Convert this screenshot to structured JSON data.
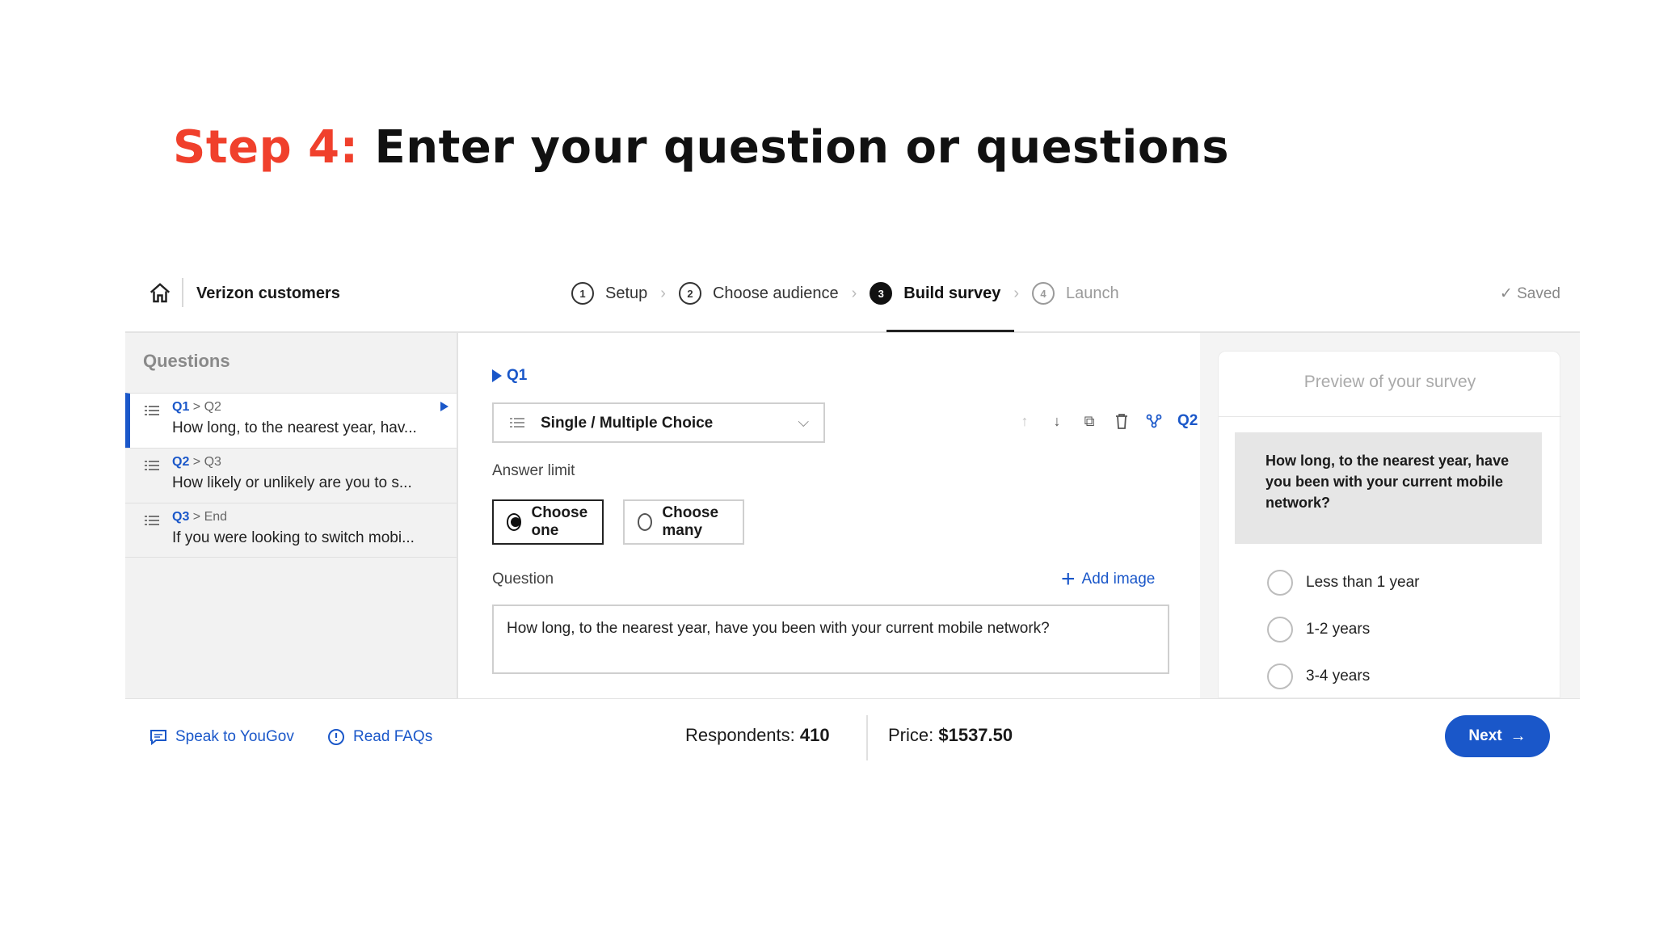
{
  "headline": {
    "step": "Step 4:",
    "text": "Enter your question or questions"
  },
  "topbar": {
    "project": "Verizon customers",
    "steps": [
      {
        "num": "1",
        "label": "Setup"
      },
      {
        "num": "2",
        "label": "Choose audience"
      },
      {
        "num": "3",
        "label": "Build survey"
      },
      {
        "num": "4",
        "label": "Launch"
      }
    ],
    "saved": "✓ Saved"
  },
  "sidebar": {
    "title": "Questions",
    "items": [
      {
        "id": "Q1",
        "next": "> Q2",
        "text": "How long, to the nearest year, hav..."
      },
      {
        "id": "Q2",
        "next": "> Q3",
        "text": "How likely or unlikely are you to s..."
      },
      {
        "id": "Q3",
        "next": "> End",
        "text": "If you were looking to switch mobi..."
      }
    ]
  },
  "editor": {
    "qid": "Q1",
    "type": "Single / Multiple Choice",
    "next_link": "Q2",
    "answer_limit_label": "Answer limit",
    "choose_one": "Choose one",
    "choose_many": "Choose many",
    "question_label": "Question",
    "add_image": "Add image",
    "question_text": "How long, to the nearest year, have you been with your current mobile network?"
  },
  "preview": {
    "title": "Preview of your survey",
    "question": "How long, to the nearest year, have you been with your current mobile network?",
    "options": [
      "Less than 1 year",
      "1-2 years",
      "3-4 years"
    ]
  },
  "footer": {
    "speak": "Speak to YouGov",
    "faqs": "Read FAQs",
    "respondents_label": "Respondents: ",
    "respondents": "410",
    "price_label": "Price: ",
    "price": "$1537.50",
    "next": "Next"
  },
  "colors": {
    "accent": "#1a57c9",
    "step": "#f0402c"
  }
}
